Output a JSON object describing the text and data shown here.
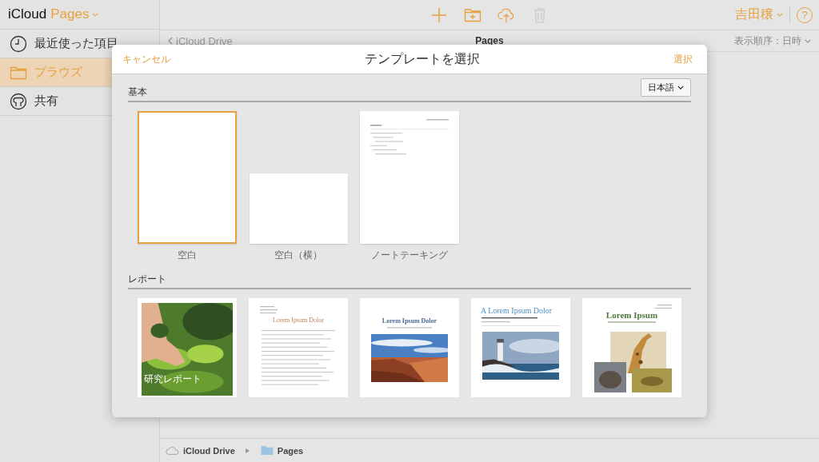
{
  "app": {
    "brand": "iCloud",
    "app_name": "Pages"
  },
  "sidebar": {
    "items": [
      {
        "label": "最近使った項目",
        "kind": "clock",
        "selected": false
      },
      {
        "label": "ブラウズ",
        "kind": "folder",
        "selected": true
      },
      {
        "label": "共有",
        "kind": "person",
        "selected": false
      }
    ]
  },
  "toolbar": {
    "user": "吉田穣",
    "help": "?"
  },
  "browser": {
    "back": "iCloud Drive",
    "title": "Pages",
    "sort": "表示順序：日時"
  },
  "dialog": {
    "cancel": "キャンセル",
    "title": "テンプレートを選択",
    "confirm": "選択",
    "sections": [
      {
        "title": "基本",
        "language": "日本語",
        "templates": [
          {
            "kind": "blank",
            "label": "空白",
            "selected": true
          },
          {
            "kind": "landscape",
            "label": "空白（横）",
            "selected": false
          },
          {
            "kind": "notes",
            "label": "ノートテーキング",
            "selected": false
          }
        ]
      },
      {
        "title": "レポート",
        "templates": [
          {
            "kind": "cover",
            "heading": "研究レポート",
            "selected": false
          },
          {
            "kind": "essay",
            "heading": "Lorem Ipsum Dolor",
            "selected": false
          },
          {
            "kind": "canyon",
            "heading": "Lorem Ipsum Dolor",
            "selected": false
          },
          {
            "kind": "lighthouse",
            "heading": "A Lorem Ipsum Dolor",
            "selected": false
          },
          {
            "kind": "collage",
            "heading": "Lorem Ipsum",
            "selected": false
          }
        ]
      }
    ]
  },
  "path_bar": {
    "items": [
      {
        "label": "iCloud Drive",
        "kind": "cloud"
      },
      {
        "label": "Pages",
        "kind": "folder"
      }
    ]
  }
}
